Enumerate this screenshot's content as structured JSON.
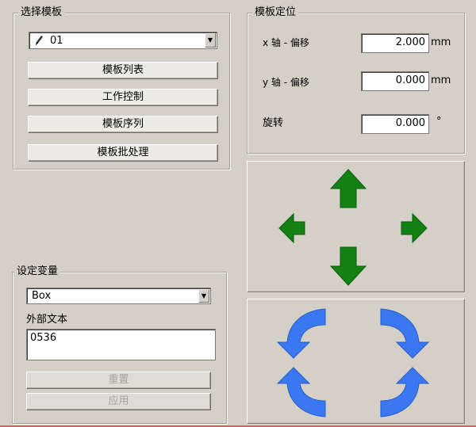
{
  "template_select": {
    "title": "选择模板",
    "selected": "01",
    "buttons": [
      "模板列表",
      "工作控制",
      "模板序列",
      "模板批处理"
    ]
  },
  "template_position": {
    "title": "模板定位",
    "x_label": "x 轴 - 偏移",
    "x_value": "2.000",
    "x_unit": "mm",
    "y_label": "y 轴 - 偏移",
    "y_value": "0.000",
    "y_unit": "mm",
    "rot_label": "旋转",
    "rot_value": "0.000",
    "rot_unit": "°"
  },
  "variables": {
    "title": "设定变量",
    "selected": "Box",
    "external_text_label": "外部文本",
    "external_text_value": "0536",
    "reset_label": "重置",
    "apply_label": "应用"
  },
  "icons": {
    "pencil": "pencil-icon",
    "move_arrows": [
      "arrow-up-icon",
      "arrow-left-icon",
      "arrow-right-icon",
      "arrow-down-icon"
    ],
    "rotate_arrows": [
      "rotate-ccw-top-left-icon",
      "rotate-cw-top-right-icon",
      "rotate-cw-bottom-left-icon",
      "rotate-ccw-bottom-right-icon"
    ]
  },
  "colors": {
    "move_arrow": "#138013",
    "rotate_arrow": "#3a78f2",
    "background": "#d4d0c8"
  }
}
